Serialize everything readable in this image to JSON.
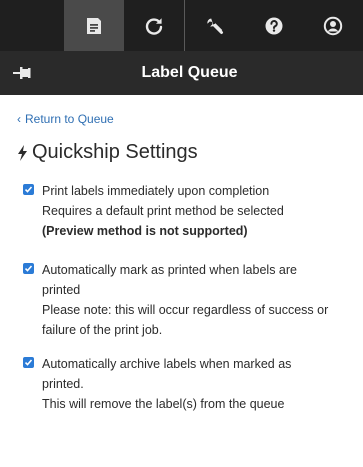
{
  "toolbar": {
    "buttons": [
      {
        "icon": "printer-icon",
        "active": true
      },
      {
        "icon": "refresh-icon",
        "active": false
      },
      {
        "icon": "wrench-icon",
        "active": false
      },
      {
        "icon": "help-icon",
        "active": false
      },
      {
        "icon": "user-account-icon",
        "active": false
      }
    ]
  },
  "header": {
    "title": "Label Queue",
    "pin_icon": "pin-icon"
  },
  "back_link": "Return to Queue",
  "page_title": "Quickship Settings",
  "title_icon": "lightning-bolt-icon",
  "options": [
    {
      "checked": true,
      "label_lines": [
        "Print labels immediately upon completion",
        "Requires a default print method be selected"
      ],
      "emphasis": "(Preview method is not supported)"
    },
    {
      "checked": true,
      "label_lines": [
        "Automatically mark as printed when labels are",
        "printed",
        "Please note: this will occur regardless of success or",
        "failure of the print job."
      ]
    },
    {
      "checked": true,
      "label_lines": [
        "Automatically archive labels when marked as",
        "printed.",
        "This will remove the label(s) from the queue"
      ]
    }
  ],
  "colors": {
    "toolbar_bg": "#1f1f1f",
    "active_bg": "#4a4a4a",
    "titlebar_bg": "#2a2a2a",
    "link": "#2f6fb3",
    "checkbox": "#2b7bd6"
  }
}
